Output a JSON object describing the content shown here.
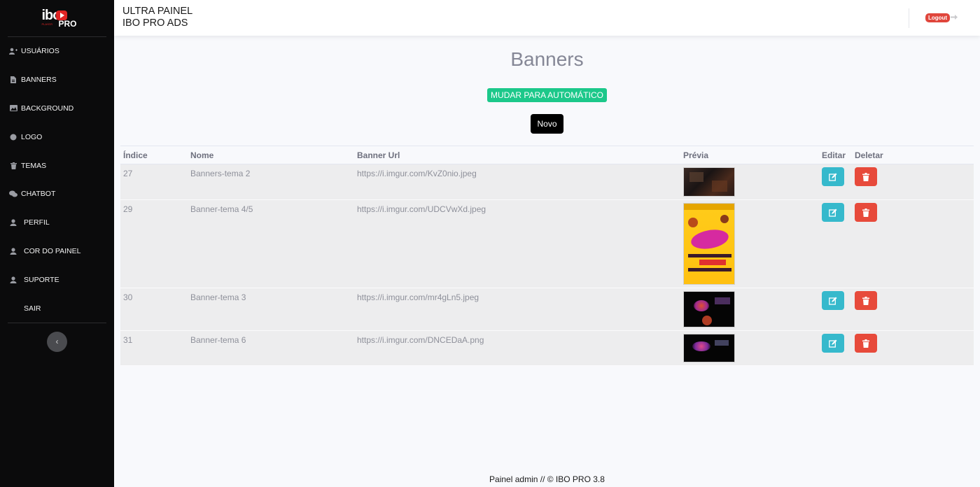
{
  "brand": {
    "name": "ibo",
    "sub": "PRO",
    "tagline": "PLAYER"
  },
  "sidebar": {
    "items": [
      {
        "label": "USUÁRIOS",
        "icon": "user-plus-icon"
      },
      {
        "label": "BANNERS",
        "icon": "file-icon"
      },
      {
        "label": "BACKGROUND",
        "icon": "image-icon"
      },
      {
        "label": "LOGO",
        "icon": "circle-icon"
      },
      {
        "label": "TEMAS",
        "icon": "trash-icon"
      },
      {
        "label": "CHATBOT",
        "icon": "comments-icon"
      },
      {
        "label": "PERFIL",
        "icon": "user-icon"
      },
      {
        "label": "COR DO PAINEL",
        "icon": "user-icon"
      },
      {
        "label": "SUPORTE",
        "icon": "user-icon"
      },
      {
        "label": "SAIR",
        "icon": ""
      }
    ],
    "toggle_icon": "‹"
  },
  "topbar": {
    "title_line1": "ULTRA PAINEL",
    "title_line2": "IBO PRO ADS",
    "logout_label": "Logout"
  },
  "main": {
    "title": "Banners",
    "auto_button": "MUDAR PARA AUTOMÁTICO",
    "new_button": "Novo"
  },
  "table": {
    "headers": [
      "Índice",
      "Nome",
      "Banner Url",
      "Prévia",
      "Editar",
      "Deletar"
    ],
    "rows": [
      {
        "index": "27",
        "name": "Banners-tema 2",
        "url": "https://i.imgur.com/KvZ0nio.jpeg"
      },
      {
        "index": "29",
        "name": "Banner-tema 4/5",
        "url": "https://i.imgur.com/UDCVwXd.jpeg"
      },
      {
        "index": "30",
        "name": "Banner-tema 3",
        "url": "https://i.imgur.com/mr4gLn5.jpeg"
      },
      {
        "index": "31",
        "name": "Banner-tema 6",
        "url": "https://i.imgur.com/DNCEDaA.png"
      }
    ]
  },
  "footer": {
    "text": "Painel admin // © IBO PRO 3.8"
  },
  "colors": {
    "sidebar_bg": "#0b0b0c",
    "success": "#1cc88a",
    "info": "#36b9cc",
    "danger": "#e74a3b",
    "logout": "#e0463c"
  }
}
